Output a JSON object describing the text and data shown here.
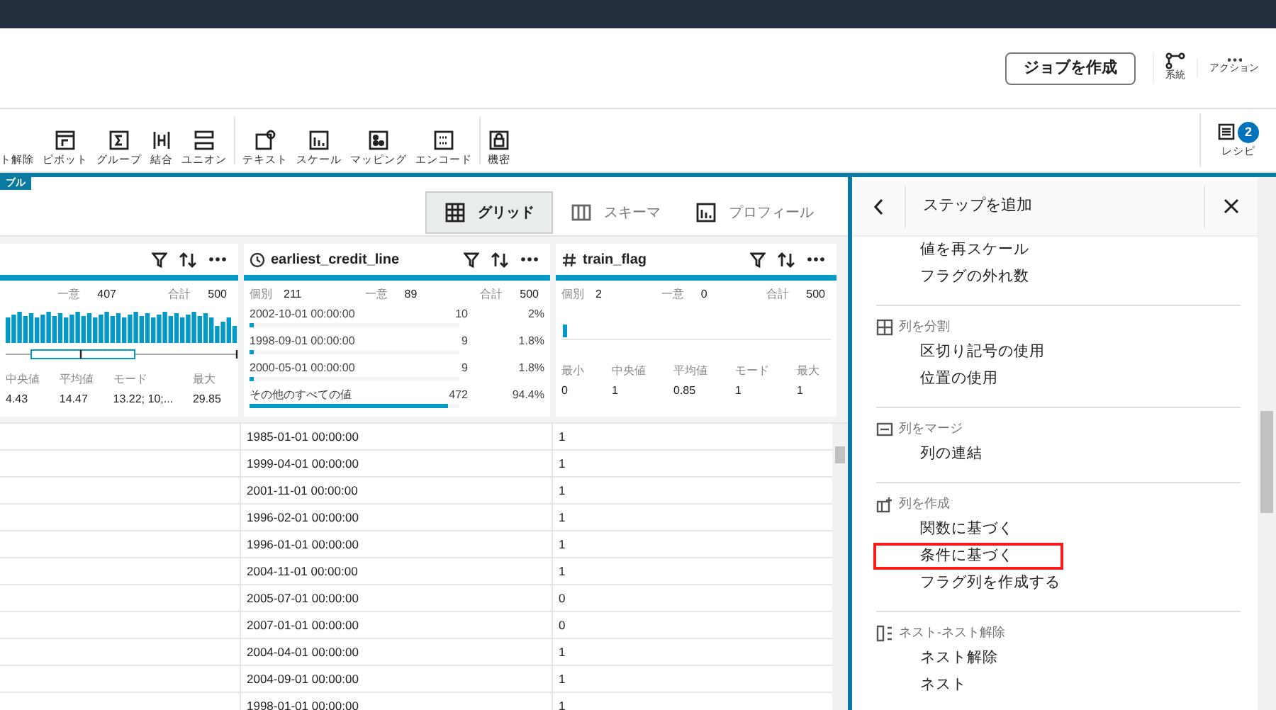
{
  "header": {
    "create_job_button": "ジョブを作成",
    "lineage": "系統",
    "actions": "アクション"
  },
  "toolbar": {
    "groups": [
      [
        {
          "label": "ト解除"
        },
        {
          "label": "ピボット"
        },
        {
          "label": "グループ"
        },
        {
          "label": "結合"
        },
        {
          "label": "ユニオン"
        }
      ],
      [
        {
          "label": "テキスト"
        },
        {
          "label": "スケール"
        },
        {
          "label": "マッピング"
        },
        {
          "label": "エンコード"
        }
      ],
      [
        {
          "label": "機密"
        }
      ]
    ],
    "recipe": {
      "label": "レシピ",
      "badge": "2"
    }
  },
  "dataset_tab": "ブル",
  "views": [
    {
      "label": "グリッド",
      "selected": true
    },
    {
      "label": "スキーマ",
      "selected": false
    },
    {
      "label": "プロフィール",
      "selected": false
    }
  ],
  "columns": [
    {
      "kind": "numeric",
      "unique_label": "一意",
      "unique": "407",
      "total_label": "合計",
      "total": "500",
      "stats": [
        {
          "label": "中央値",
          "value": "4.43"
        },
        {
          "label": "平均値",
          "value": "14.47"
        },
        {
          "label": "モード",
          "value": "13.22; 10;..."
        },
        {
          "label": "最大",
          "value": "29.85"
        }
      ]
    },
    {
      "kind": "top_values",
      "name": "earliest_credit_line",
      "distinct_label": "個別",
      "distinct": "211",
      "unique_label": "一意",
      "unique": "89",
      "total_label": "合計",
      "total": "500",
      "top_values": [
        {
          "value": "2002-10-01 00:00:00",
          "count": "10",
          "percent": "2%",
          "level": 0.02
        },
        {
          "value": "1998-09-01 00:00:00",
          "count": "9",
          "percent": "1.8%",
          "level": 0.018
        },
        {
          "value": "2000-05-01 00:00:00",
          "count": "9",
          "percent": "1.8%",
          "level": 0.018
        },
        {
          "value": "その他のすべての値",
          "count": "472",
          "percent": "94.4%",
          "level": 0.944
        }
      ]
    },
    {
      "kind": "flag",
      "name": "train_flag",
      "distinct_label": "個別",
      "distinct": "2",
      "unique_label": "一意",
      "unique": "0",
      "total_label": "合計",
      "total": "500",
      "stats": [
        {
          "label": "最小",
          "value": "0"
        },
        {
          "label": "中央値",
          "value": "1"
        },
        {
          "label": "平均値",
          "value": "0.85"
        },
        {
          "label": "モード",
          "value": "1"
        },
        {
          "label": "最大",
          "value": "1"
        }
      ]
    }
  ],
  "rows": [
    [
      "1985-01-01 00:00:00",
      "1"
    ],
    [
      "1999-04-01 00:00:00",
      "1"
    ],
    [
      "2001-11-01 00:00:00",
      "1"
    ],
    [
      "1996-02-01 00:00:00",
      "1"
    ],
    [
      "1996-01-01 00:00:00",
      "1"
    ],
    [
      "2004-11-01 00:00:00",
      "1"
    ],
    [
      "2005-07-01 00:00:00",
      "0"
    ],
    [
      "2007-01-01 00:00:00",
      "0"
    ],
    [
      "2004-04-01 00:00:00",
      "1"
    ],
    [
      "2004-09-01 00:00:00",
      "1"
    ],
    [
      "1998-01-01 00:00:00",
      "1"
    ]
  ],
  "panel": {
    "title": "ステップを追加",
    "sections": [
      {
        "items": [
          {
            "label": "値を再スケール",
            "highlighted": false
          },
          {
            "label": "フラグの外れ数",
            "highlighted": false
          }
        ]
      },
      {
        "title": "列を分割",
        "items": [
          {
            "label": "区切り記号の使用",
            "highlighted": false
          },
          {
            "label": "位置の使用",
            "highlighted": false
          }
        ]
      },
      {
        "title": "列をマージ",
        "items": [
          {
            "label": "列の連結",
            "highlighted": false
          }
        ]
      },
      {
        "title": "列を作成",
        "items": [
          {
            "label": "関数に基づく",
            "highlighted": false
          },
          {
            "label": "条件に基づく",
            "highlighted": true
          },
          {
            "label": "フラグ列を作成する",
            "highlighted": false
          }
        ]
      },
      {
        "title": "ネスト-ネスト解除",
        "items": [
          {
            "label": "ネスト解除",
            "highlighted": false
          },
          {
            "label": "ネスト",
            "highlighted": false
          }
        ]
      }
    ]
  }
}
